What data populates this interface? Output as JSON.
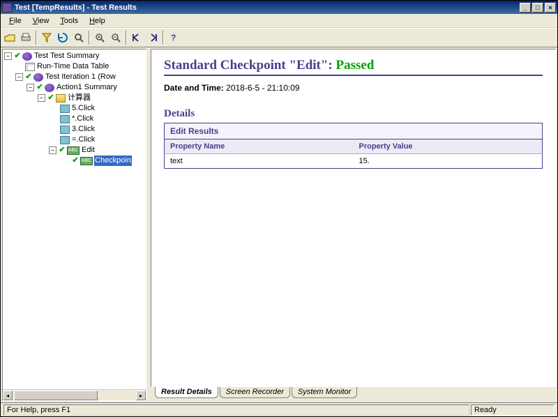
{
  "window": {
    "title": "Test [TempResults] - Test Results",
    "min_label": "_",
    "max_label": "□",
    "close_label": "×"
  },
  "menu": {
    "file": "File",
    "view": "View",
    "tools": "Tools",
    "help": "Help"
  },
  "tree": {
    "root": "Test Test Summary",
    "data_table": "Run-Time Data Table",
    "iteration": "Test Iteration 1 (Row",
    "action": "Action1 Summary",
    "calc": "计算器",
    "n1": "5.Click",
    "n2": "*.Click",
    "n3": "3.Click",
    "n4": "=.Click",
    "edit": "Edit",
    "checkpoint": "Checkpoin"
  },
  "details": {
    "heading_prefix": "Standard Checkpoint \"Edit\": ",
    "status": "Passed",
    "datetime_label": "Date and Time:",
    "datetime_value": "2018-6-5 - 21:10:09",
    "details_heading": "Details",
    "table_header": "Edit Results",
    "col_name": "Property Name",
    "col_value": "Property Value",
    "row_name": "text",
    "row_value": "15."
  },
  "tabs": {
    "t1": "Result Details",
    "t2": "Screen Recorder",
    "t3": "System Monitor"
  },
  "status": {
    "help": "For Help, press F1",
    "ready": "Ready"
  }
}
